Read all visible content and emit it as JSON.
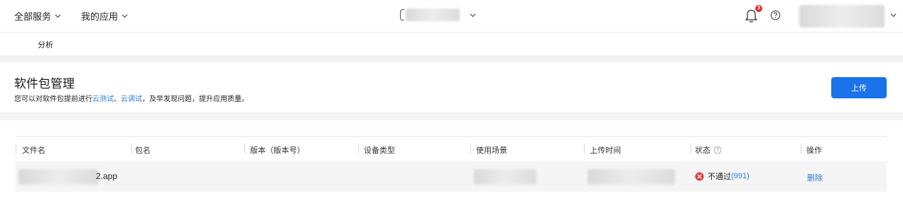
{
  "topbar": {
    "all_services": "全部服务",
    "my_apps": "我的应用",
    "notification_count": "3"
  },
  "subnav": {
    "tab_analysis": "分析"
  },
  "header": {
    "title": "软件包管理",
    "desc_prefix": "您可以对软件包提前进行",
    "link_cloud_test": "云测试",
    "desc_sep": "、",
    "link_cloud_debug": "云调试",
    "desc_suffix": "，及早发现问题，提升应用质量。",
    "upload_label": "上传"
  },
  "table": {
    "columns": [
      "文件名",
      "包名",
      "版本（版本号）",
      "设备类型",
      "使用场景",
      "上传时间",
      "状态",
      "操作"
    ],
    "rows": [
      {
        "file_suffix": "2.app",
        "status_text": "不通过",
        "status_count": "(991)",
        "action": "删除"
      }
    ]
  },
  "colors": {
    "primary": "#1a73e8",
    "link": "#2f7ad8",
    "badge": "#e5302f",
    "error": "#e8393b"
  }
}
